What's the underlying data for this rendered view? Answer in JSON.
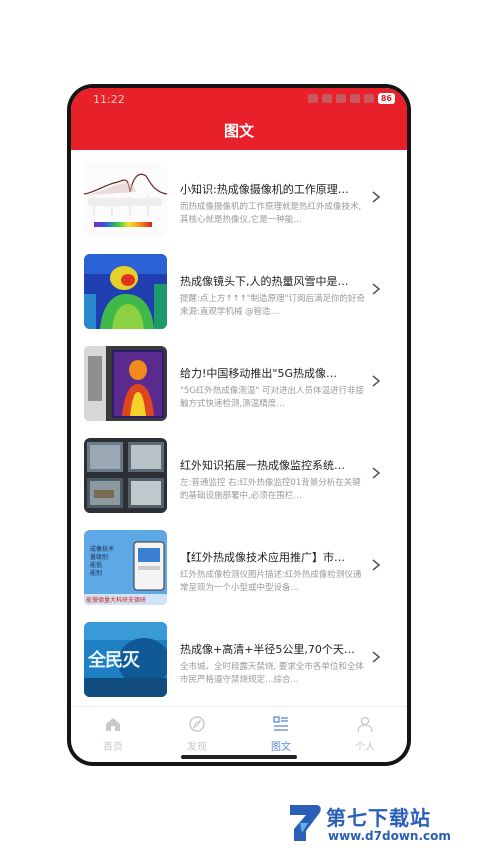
{
  "status_bar": {
    "time": "11:22",
    "battery": "86"
  },
  "header": {
    "title": "图文"
  },
  "articles": [
    {
      "title": "小知识:热成像摄像机的工作原理…",
      "desc": "而热成像摄像机的工作原理就是热红外成像技术,其核心就是热像仪,它是一种能…"
    },
    {
      "title": "热成像镜头下,人的热量风雪中是…",
      "desc": "提醒:点上方↑↑↑\"制造原理\"订阅后满足你的好奇来源:直观学机械 @智造…"
    },
    {
      "title": "给力!中国移动推出\"5G热成像…",
      "desc": "\"5G红外热成像测温\" 可对进出人员体温进行非接触方式快速检测,测温精度…"
    },
    {
      "title": "红外知识拓展一热成像监控系统…",
      "desc": "左:普通监控 右:红外热像监控01背景分析在关键的基础设施部署中,必须在围栏…"
    },
    {
      "title": "【红外热成像技术应用推广】市…",
      "desc": "红外热成像检测仪图片描述:红外热成像检测仪通常呈现为一个小型或中型设备…"
    },
    {
      "title": "热成像+高清+半径5公里,70个天…",
      "desc": "全市城、全时段露天禁烧, 要求全市各单位和全体市民严格遵守禁烧规定…综合…"
    }
  ],
  "thumb_texts": {
    "t5_lines": [
      "成像技术",
      "量级别",
      "能低",
      "能别"
    ],
    "t5_footer": "能慢德量大科研支德研",
    "t6_text": "全民灭"
  },
  "tabs": [
    {
      "label": "首页",
      "icon": "home-icon",
      "active": false
    },
    {
      "label": "发现",
      "icon": "discover-icon",
      "active": false
    },
    {
      "label": "图文",
      "icon": "article-icon",
      "active": true
    },
    {
      "label": "个人",
      "icon": "person-icon",
      "active": false
    }
  ],
  "watermark": {
    "text": "第七下载站",
    "url": "www.d7down.com"
  },
  "colors": {
    "accent": "#e8202a",
    "tab_active": "#5a8ad6",
    "tab_inactive": "#c8c8c8"
  }
}
